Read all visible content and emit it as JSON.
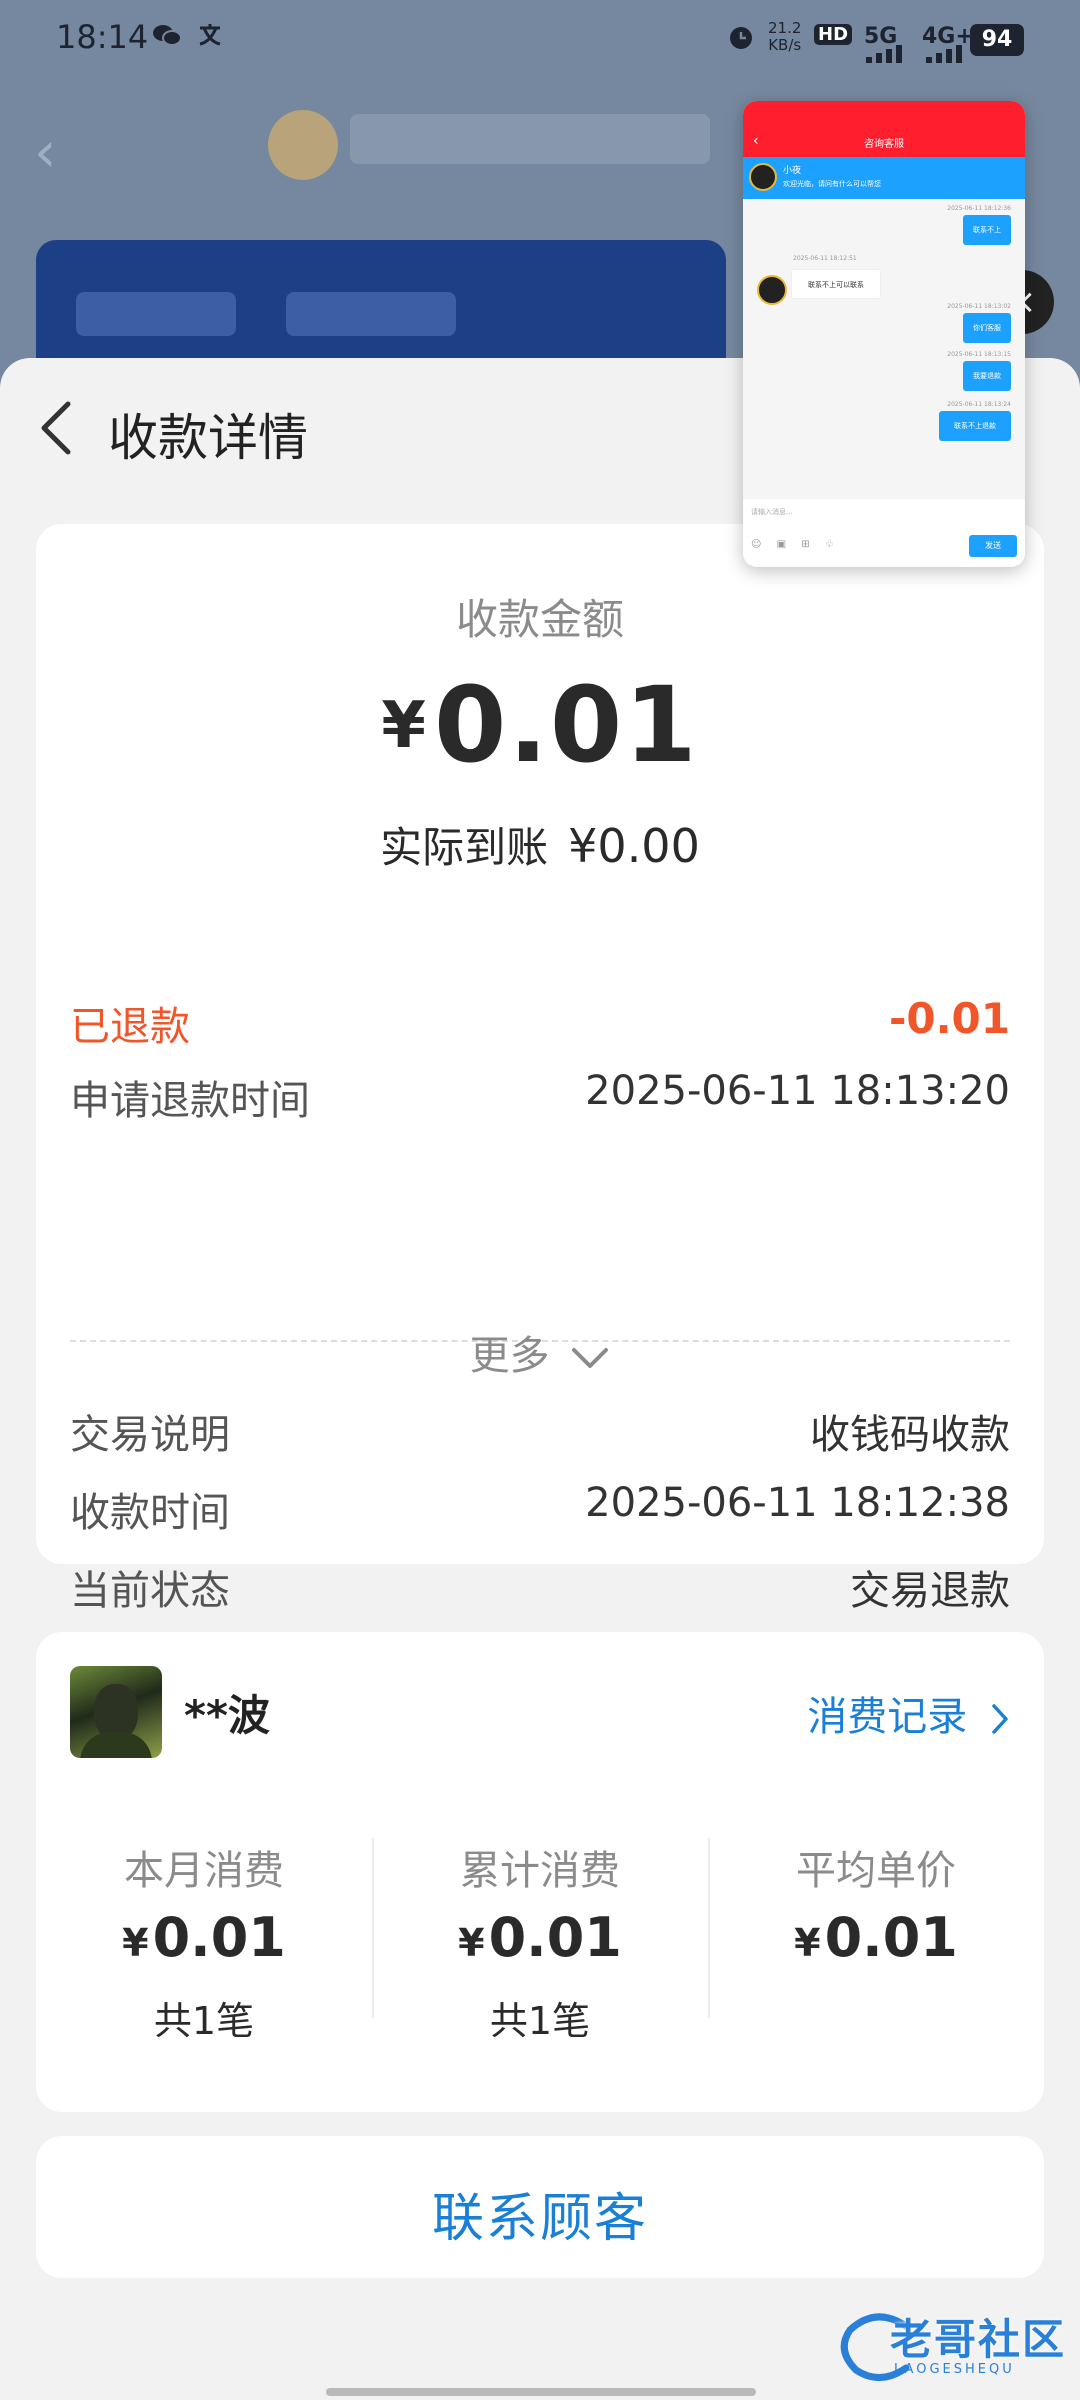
{
  "status_bar": {
    "time": "18:14",
    "wechat_icon": "wechat-icon",
    "net_speed": "21.2",
    "net_unit": "KB/s",
    "hd": "HD",
    "signal1": "5G",
    "signal2": "4G+",
    "battery": "94"
  },
  "sheet": {
    "title": "收款详情"
  },
  "amount": {
    "label": "收款金额",
    "currency": "¥",
    "value": "0.01",
    "actual_label": "实际到账",
    "actual_value": "¥0.00"
  },
  "refund": {
    "label": "已退款",
    "value": "-0.01",
    "apply_time_label": "申请退款时间",
    "apply_time": "2025-06-11 18:13:20"
  },
  "details": {
    "desc_label": "交易说明",
    "desc_value": "收钱码收款",
    "time_label": "收款时间",
    "time_value": "2025-06-11 18:12:38",
    "status_label": "当前状态",
    "status_value": "交易退款",
    "more": "更多"
  },
  "customer": {
    "name": "**波",
    "record_link": "消费记录",
    "stats": [
      {
        "label": "本月消费",
        "currency": "¥",
        "value": "0.01",
        "count": "共1笔"
      },
      {
        "label": "累计消费",
        "currency": "¥",
        "value": "0.01",
        "count": "共1笔"
      },
      {
        "label": "平均单价",
        "currency": "¥",
        "value": "0.01",
        "count": ""
      }
    ]
  },
  "contact": {
    "label": "联系顾客"
  },
  "watermark": {
    "text": "老哥社区",
    "sub": "LAOGESHEQU"
  },
  "pip_chat": {
    "title": "咨询客服",
    "banner_name": "小夜",
    "banner_text": "欢迎光临，请问有什么可以帮您",
    "messages": [
      {
        "dir": "out",
        "time": "2025-06-11 18:12:36",
        "text": "联系不上"
      },
      {
        "dir": "in",
        "time": "2025-06-11 18:12:51",
        "text": "联系不上可以联系"
      },
      {
        "dir": "out",
        "time": "2025-06-11 18:13:02",
        "text": "你们客服"
      },
      {
        "dir": "out",
        "time": "2025-06-11 18:13:15",
        "text": "我要退款"
      },
      {
        "dir": "out",
        "time": "2025-06-11 18:13:24",
        "text": "联系不上退款"
      }
    ],
    "input_placeholder": "请输入消息...",
    "send": "发送"
  },
  "colors": {
    "accent_blue": "#1a7fd6",
    "refund_orange": "#f0562a",
    "pip_red": "#ff1e2e",
    "pip_blue": "#1da1ff"
  }
}
